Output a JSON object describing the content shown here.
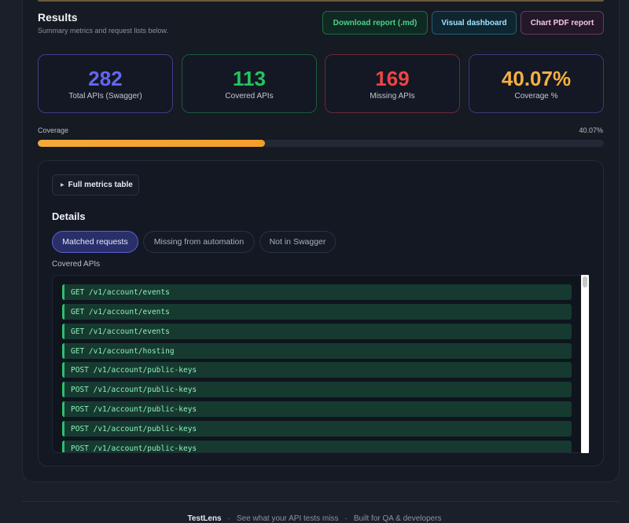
{
  "header": {
    "title": "Results",
    "subtitle": "Summary metrics and request lists below."
  },
  "actions": {
    "download_md": "Download report (.md)",
    "visual_dashboard": "Visual dashboard",
    "chart_pdf": "Chart PDF report"
  },
  "stats": {
    "total": {
      "value": "282",
      "label": "Total APIs (Swagger)",
      "color": "#6366f1"
    },
    "covered": {
      "value": "113",
      "label": "Covered APIs",
      "color": "#22c55e"
    },
    "missing": {
      "value": "169",
      "label": "Missing APIs",
      "color": "#ef4444"
    },
    "coverage": {
      "value": "40.07%",
      "label": "Coverage %",
      "color": "#f5b041"
    }
  },
  "coverage_bar": {
    "label": "Coverage",
    "percent_text": "40.07%",
    "fraction": 0.4007,
    "color": "#f2a93a"
  },
  "metrics_toggle": {
    "icon": "triangle-right-icon",
    "label": "Full metrics table"
  },
  "details": {
    "title": "Details",
    "tabs": [
      {
        "label": "Matched requests",
        "active": true
      },
      {
        "label": "Missing from automation",
        "active": false
      },
      {
        "label": "Not in Swagger",
        "active": false
      }
    ],
    "list_title": "Covered APIs",
    "items": [
      "GET /v1/account/events",
      "GET /v1/account/events",
      "GET /v1/account/events",
      "GET /v1/account/hosting",
      "POST /v1/account/public-keys",
      "POST /v1/account/public-keys",
      "POST /v1/account/public-keys",
      "POST /v1/account/public-keys",
      "POST /v1/account/public-keys"
    ]
  },
  "footer": {
    "brand": "TestLens",
    "tagline": "See what your API tests miss",
    "note": "Built for QA & developers"
  }
}
